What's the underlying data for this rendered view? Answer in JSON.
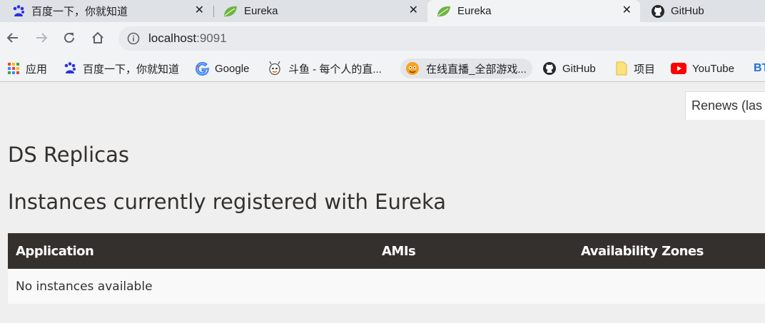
{
  "browser": {
    "tabs": [
      {
        "title": "百度一下，你就知道",
        "icon": "baidu-paw-icon",
        "active": false
      },
      {
        "title": "Eureka",
        "icon": "spring-leaf-icon",
        "active": false
      },
      {
        "title": "Eureka",
        "icon": "spring-leaf-icon",
        "active": true
      },
      {
        "title": "GitHub",
        "icon": "github-icon",
        "active": false
      }
    ],
    "close_glyph": "✕",
    "address": {
      "host": "localhost",
      "port": ":9091"
    },
    "bookmarks": [
      {
        "label": "应用",
        "icon": "apps-grid-icon"
      },
      {
        "label": "百度一下，你就知道",
        "icon": "baidu-paw-icon"
      },
      {
        "label": "Google",
        "icon": "google-icon"
      },
      {
        "label": "斗鱼 - 每个人的直...",
        "icon": "douyu-icon"
      },
      {
        "label": "在线直播_全部游戏...",
        "icon": "live-stream-icon"
      },
      {
        "label": "GitHub",
        "icon": "github-icon"
      },
      {
        "label": "项目",
        "icon": "folder-icon"
      },
      {
        "label": "YouTube",
        "icon": "youtube-icon"
      },
      {
        "label": "BT",
        "icon": "bt-text-icon"
      }
    ]
  },
  "page": {
    "renews_label": "Renews (las",
    "ds_replicas_title": "DS Replicas",
    "instances_title": "Instances currently registered with Eureka",
    "table": {
      "headers": [
        "Application",
        "AMIs",
        "Availability Zones"
      ],
      "empty_message": "No instances available"
    }
  },
  "colors": {
    "header_bg": "#34302d",
    "page_bg": "#efefef",
    "heading_text": "#34302d",
    "tabstrip_bg": "#dee1e6"
  }
}
